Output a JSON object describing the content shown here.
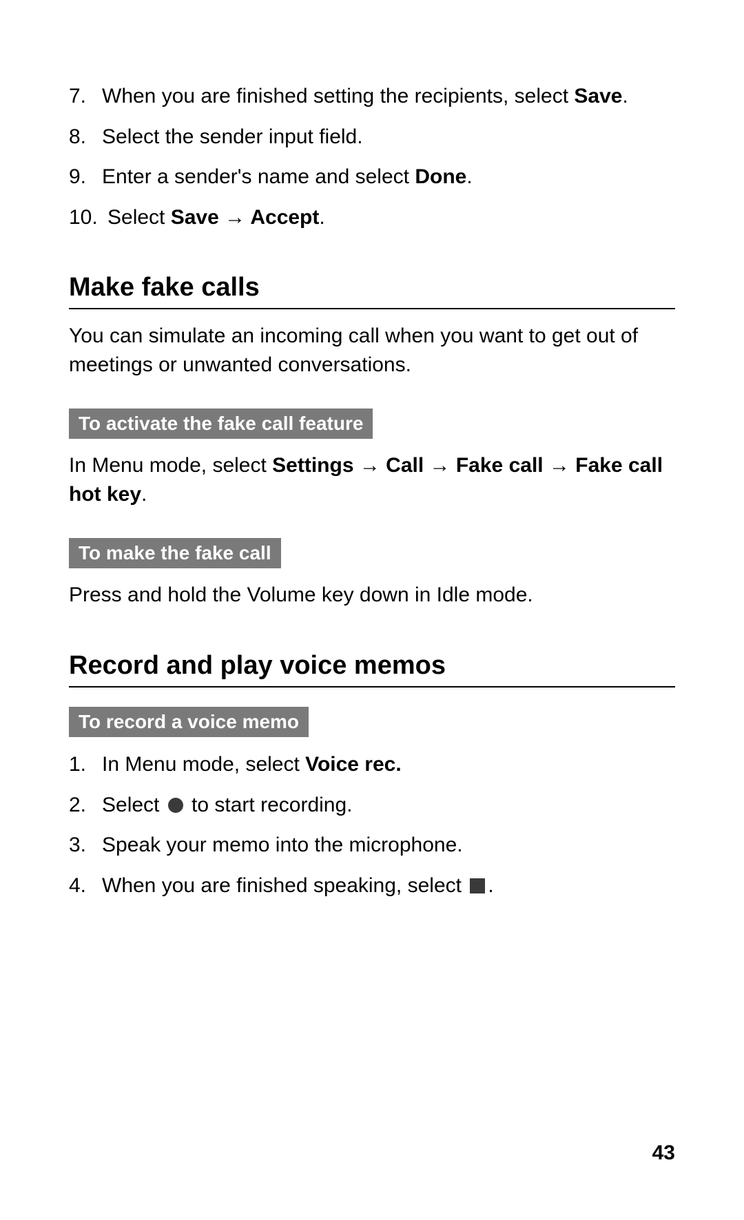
{
  "steps_top": [
    {
      "num": "7.",
      "pre": "When you are finished setting the recipients, select ",
      "bold": "Save",
      "post": "."
    },
    {
      "num": "8.",
      "pre": "Select the sender input field.",
      "bold": "",
      "post": ""
    },
    {
      "num": "9.",
      "pre": "Enter a sender's name and select ",
      "bold": "Done",
      "post": "."
    },
    {
      "num": "10.",
      "pre": "Select ",
      "bold": "Save → Accept",
      "post": "."
    }
  ],
  "section1": {
    "title": "Make fake calls",
    "intro": "You can simulate an incoming call when you want to get out of meetings or unwanted conversations.",
    "sub1_label": "To activate the fake call feature",
    "sub1_pre": "In Menu mode, select ",
    "sub1_bold": "Settings → Call → Fake call → Fake call hot key",
    "sub1_post": ".",
    "sub2_label": "To make the fake call",
    "sub2_text": "Press and hold the Volume key down in Idle mode."
  },
  "section2": {
    "title": "Record and play voice memos",
    "sub1_label": "To record a voice memo",
    "steps": [
      {
        "num": "1.",
        "pre": "In Menu mode, select ",
        "bold": "Voice rec.",
        "post": ""
      },
      {
        "num": "2.",
        "pre": "Select ",
        "icon": "record",
        "post": " to start recording."
      },
      {
        "num": "3.",
        "pre": "Speak your memo into the microphone.",
        "post": ""
      },
      {
        "num": "4.",
        "pre": "When you are finished speaking, select ",
        "icon": "stop",
        "post": "."
      }
    ]
  },
  "page_number": "43"
}
